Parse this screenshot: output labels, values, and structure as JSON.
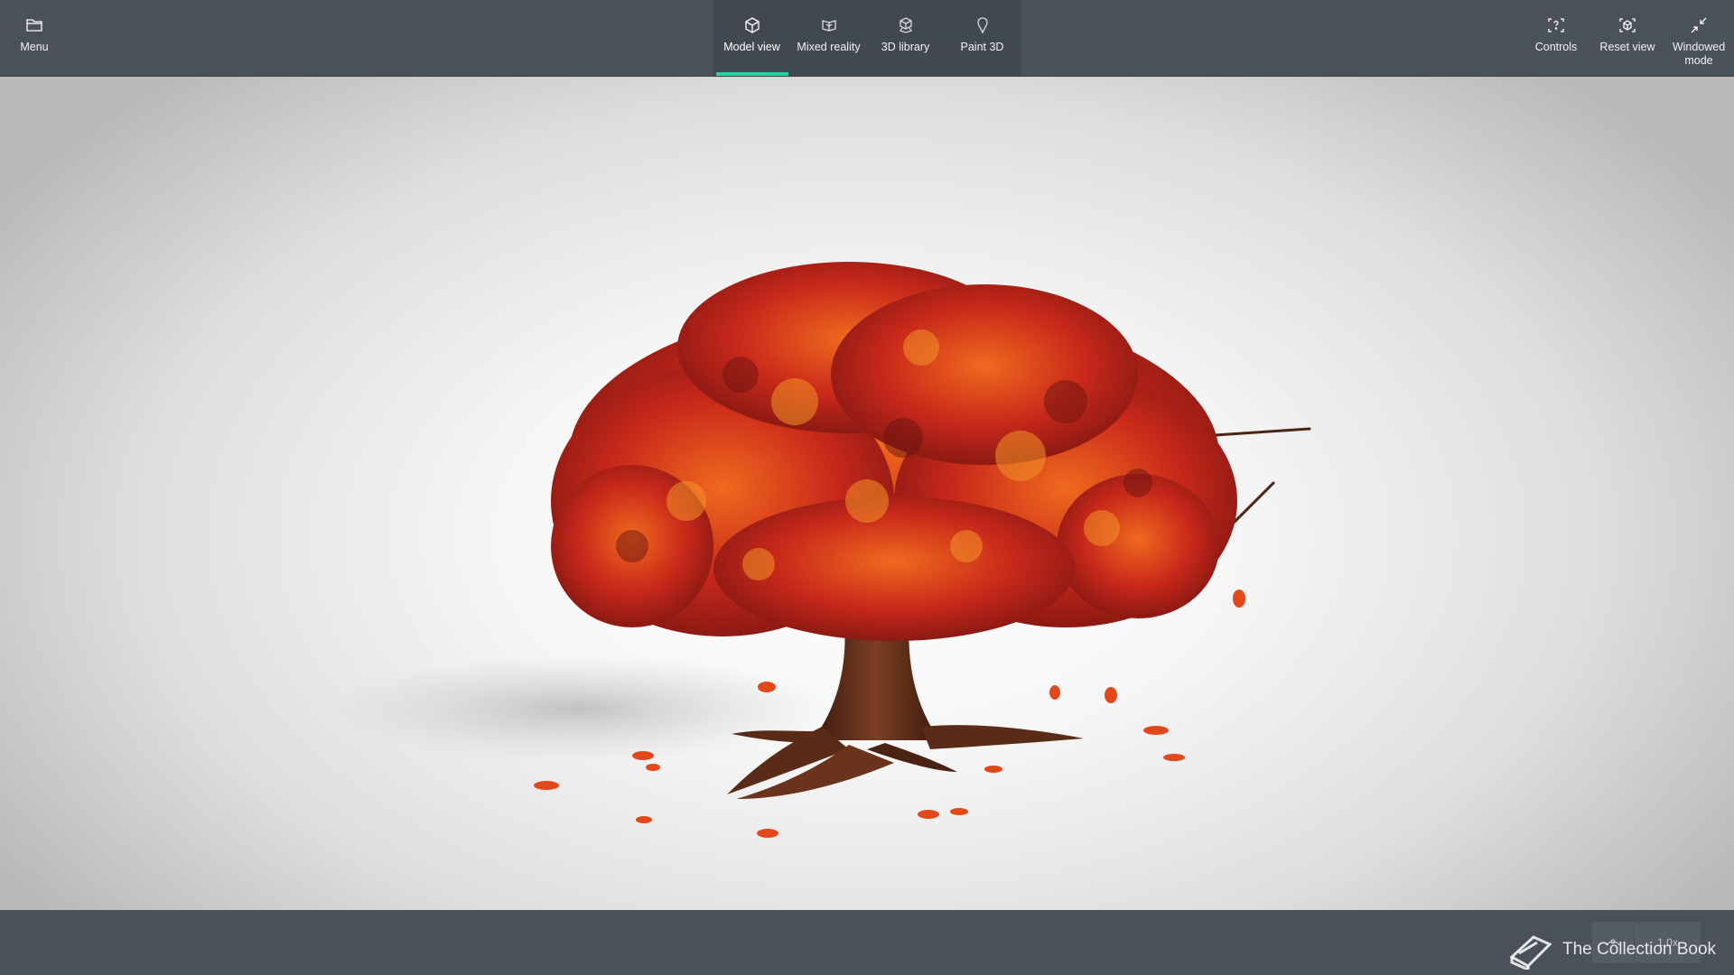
{
  "app": {
    "menu_label": "Menu",
    "menu_icon": "folder-icon"
  },
  "modes": [
    {
      "label": "Model view",
      "icon": "cube-icon",
      "active": true
    },
    {
      "label": "Mixed reality",
      "icon": "mixed-reality-icon",
      "active": false
    },
    {
      "label": "3D library",
      "icon": "library-icon",
      "active": false
    },
    {
      "label": "Paint 3D",
      "icon": "paint-3d-icon",
      "active": false
    }
  ],
  "right_actions": {
    "controls_label": "Controls",
    "reset_label": "Reset view",
    "windowed_label_1": "Windowed",
    "windowed_label_2": "mode"
  },
  "status": {
    "zoom_value": "1.0x"
  },
  "watermark": {
    "text": "The Collection Book"
  },
  "colors": {
    "accent": "#2fd0a0",
    "bar": "#4a515b"
  }
}
